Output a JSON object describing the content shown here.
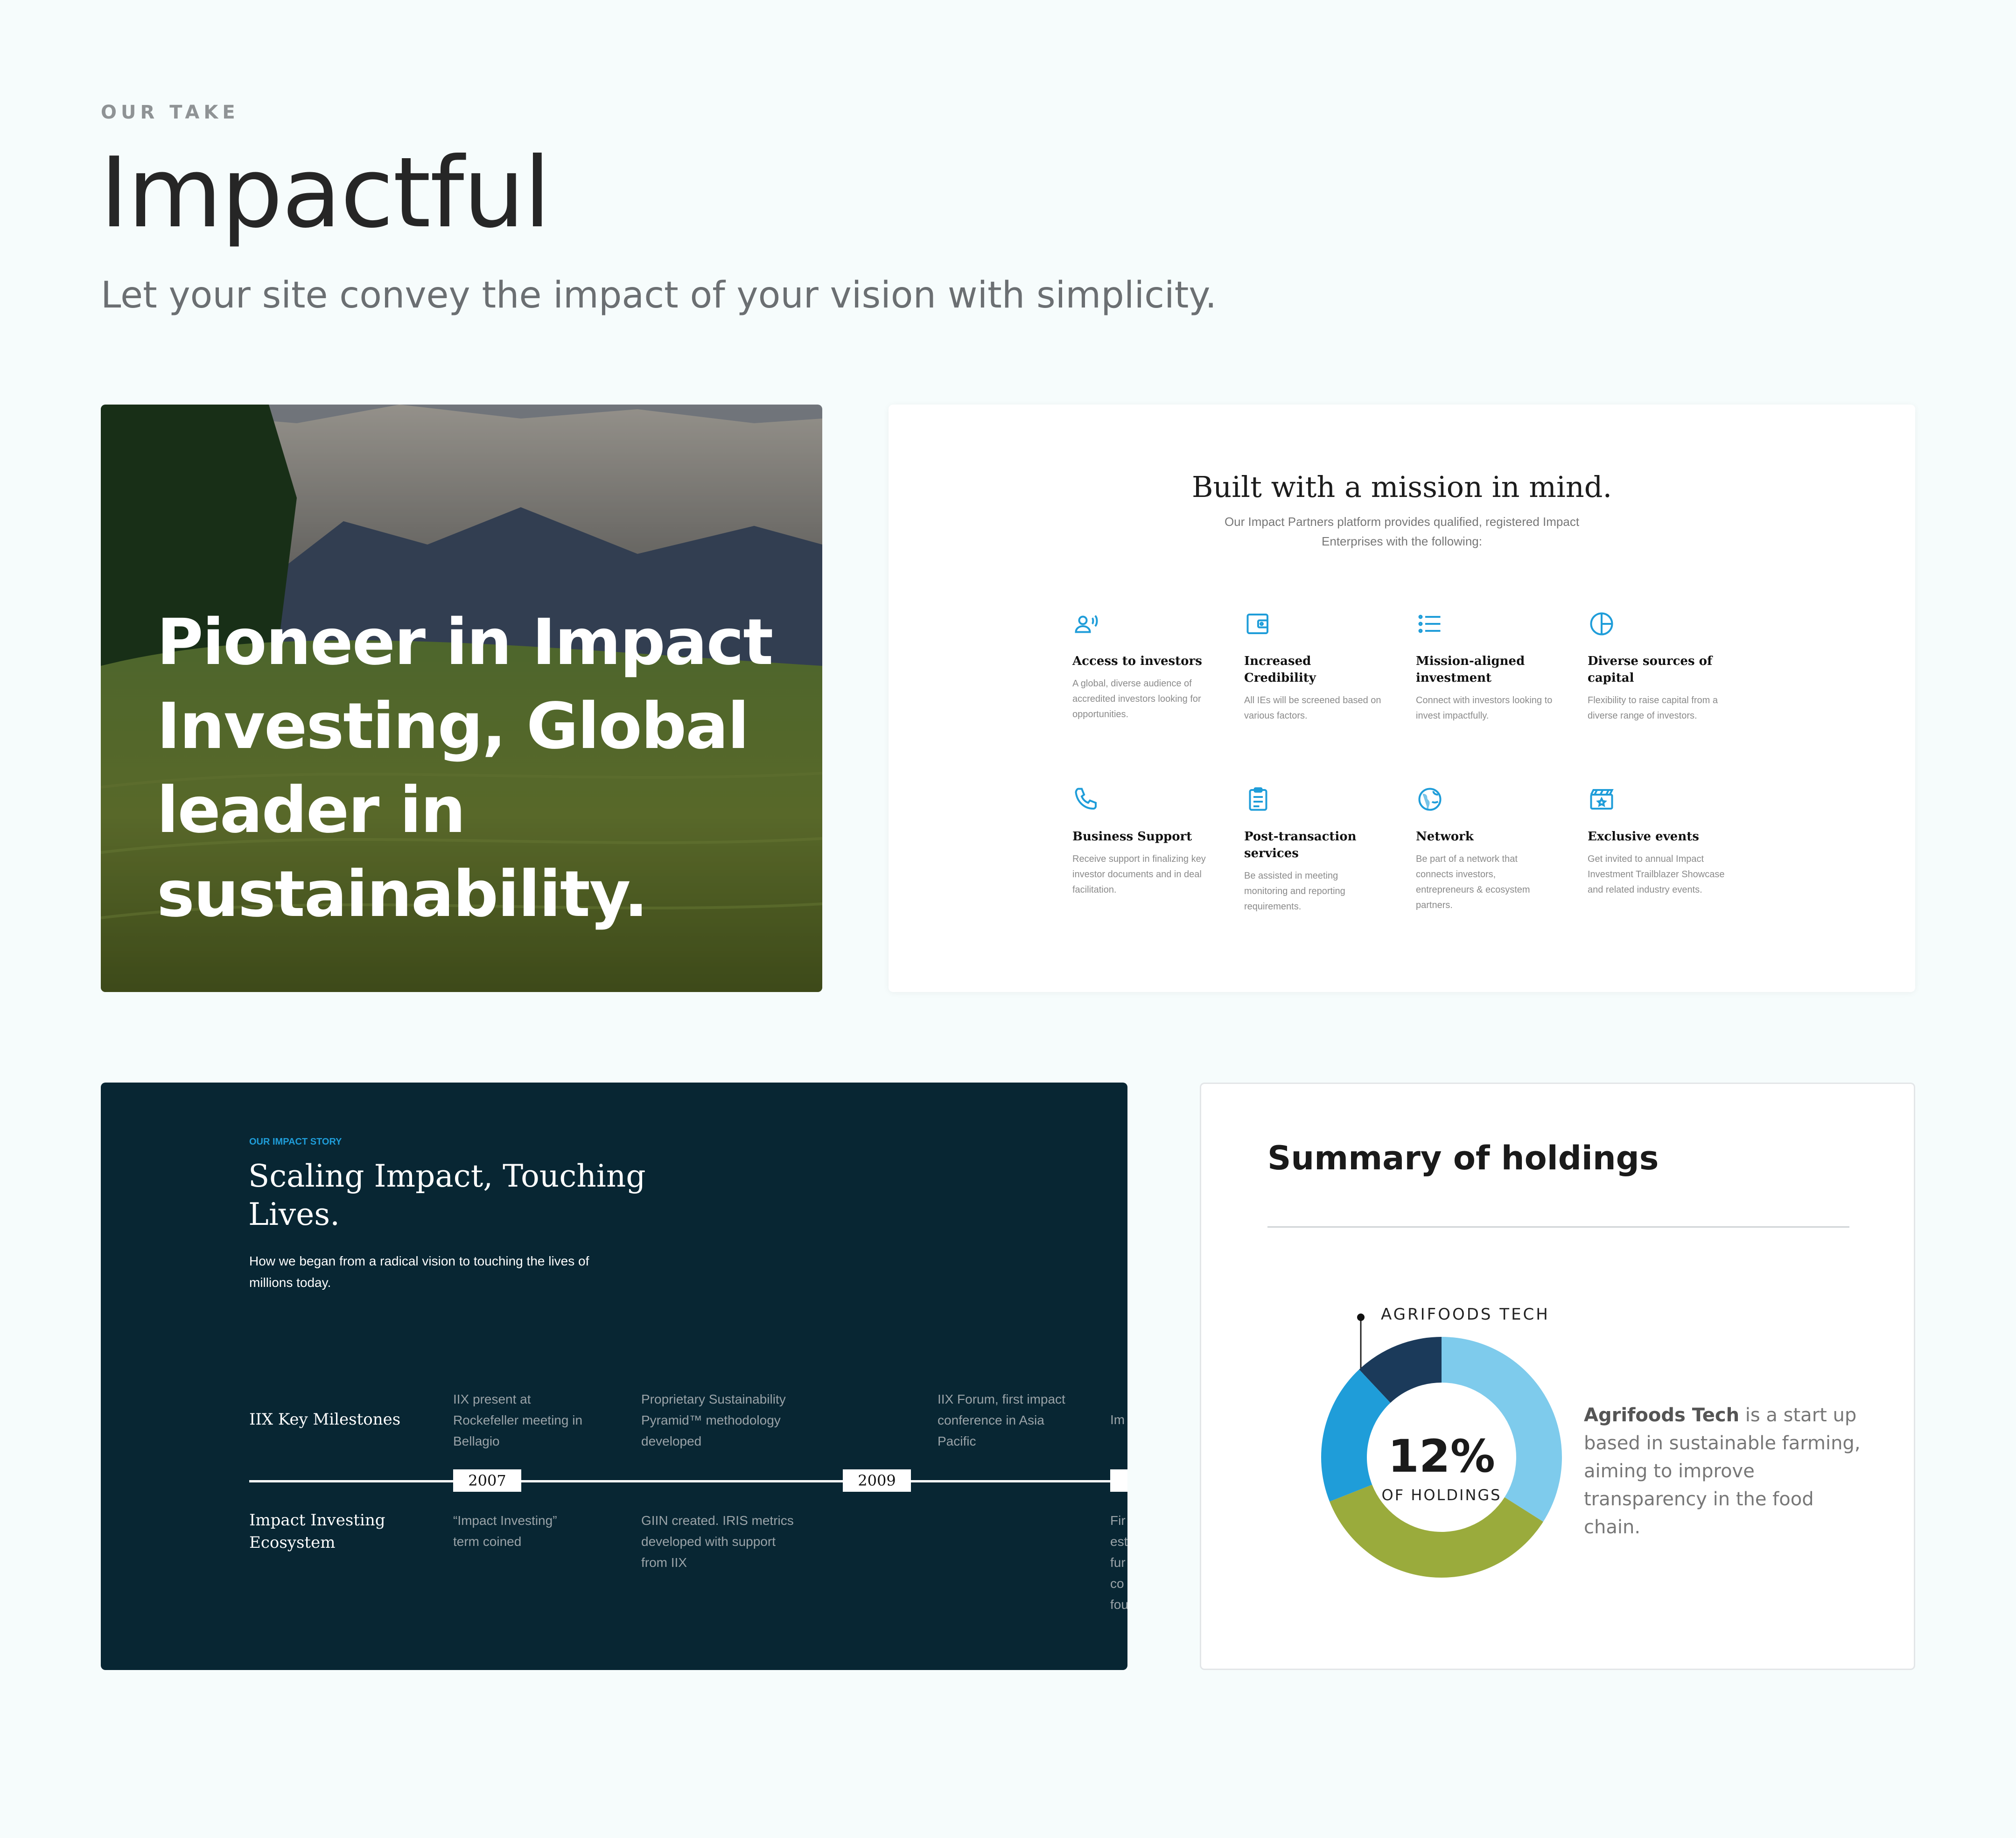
{
  "header": {
    "eyebrow": "OUR TAKE",
    "title": "Impactful",
    "subtitle": "Let your site convey the impact of your vision with simplicity."
  },
  "hero_card": {
    "text": "Pioneer in Impact Investing, Global leader in sustainability."
  },
  "mission_card": {
    "title": "Built with a mission in mind.",
    "description": "Our Impact Partners platform provides qualified, registered Impact Enterprises with the following:",
    "accent_color": "#1f9dd9",
    "features": [
      {
        "icon": "person-voice-icon",
        "title": "Access to investors",
        "desc": "A global, diverse audience of accredited investors looking for opportunities."
      },
      {
        "icon": "wallet-icon",
        "title": "Increased Credibility",
        "desc": "All IEs will be screened based on various factors."
      },
      {
        "icon": "list-icon",
        "title": "Mission-aligned investment",
        "desc": "Connect with investors looking to invest impactfully."
      },
      {
        "icon": "pie-chart-icon",
        "title": "Diverse sources of capital",
        "desc": "Flexibility to raise capital from a diverse range of investors."
      },
      {
        "icon": "phone-icon",
        "title": "Business Support",
        "desc": "Receive support in finalizing key investor documents and in deal facilitation."
      },
      {
        "icon": "clipboard-icon",
        "title": "Post-transaction services",
        "desc": "Be assisted in meeting monitoring and reporting requirements."
      },
      {
        "icon": "globe-icon",
        "title": "Network",
        "desc": "Be part of a network that connects investors, entrepreneurs & ecosystem partners."
      },
      {
        "icon": "clapperboard-icon",
        "title": "Exclusive events",
        "desc": "Get invited to annual Impact Investment Trailblazer Showcase and related industry events."
      }
    ]
  },
  "story_card": {
    "eyebrow": "OUR IMPACT STORY",
    "title": "Scaling Impact, Touching Lives.",
    "description": "How we began from a radical vision to touching the lives of millions today.",
    "row_top_label": "IIX Key Milestones",
    "row_bottom_label": "Impact Investing Ecosystem",
    "years": [
      "2007",
      "2009"
    ],
    "milestones_top": [
      "IIX present at Rockefeller meeting in Bellagio",
      "Proprietary Sustainability Pyramid™ methodology developed",
      "IIX Forum, first impact conference in Asia Pacific",
      "Im pla"
    ],
    "milestones_bottom": [
      "“Impact Investing” term coined",
      "GIIN created. IRIS metrics developed with support from IIX",
      "Fir est fur co fou"
    ],
    "background_color": "#082633"
  },
  "holdings_card": {
    "title": "Summary of holdings",
    "segment_label": "AGRIFOODS TECH",
    "percent": "12%",
    "percent_caption": "OF HOLDINGS",
    "desc_bold": "Agrifoods Tech",
    "desc_rest": " is a start up based in sustainable farming, aiming to improve transparency in the food chain.",
    "chart_data": {
      "type": "pie",
      "values": [
        12,
        34,
        35,
        19
      ],
      "colors": [
        "#1b3a5a",
        "#7ecbec",
        "#9aab3c",
        "#1f9dd9"
      ]
    }
  }
}
